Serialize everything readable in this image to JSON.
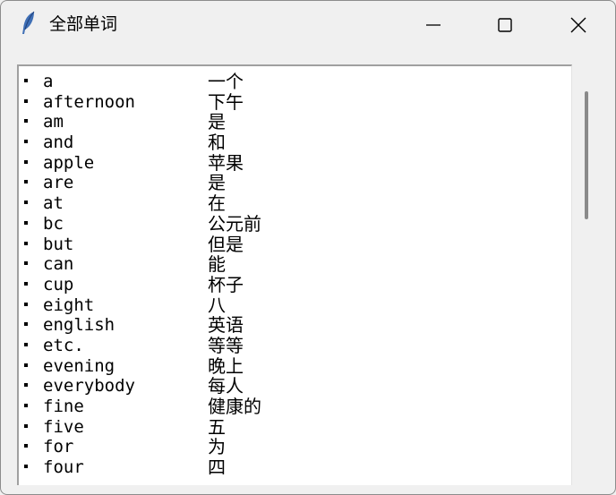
{
  "window": {
    "title": "全部单词",
    "icon": "feather-icon"
  },
  "controls": {
    "minimize_icon": "minimize-icon",
    "maximize_icon": "maximize-icon",
    "close_icon": "close-icon"
  },
  "list": {
    "items": [
      {
        "word": "a",
        "meaning": "一个"
      },
      {
        "word": "afternoon",
        "meaning": "下午"
      },
      {
        "word": "am",
        "meaning": "是"
      },
      {
        "word": "and",
        "meaning": "和"
      },
      {
        "word": "apple",
        "meaning": "苹果"
      },
      {
        "word": "are",
        "meaning": "是"
      },
      {
        "word": "at",
        "meaning": "在"
      },
      {
        "word": "bc",
        "meaning": "公元前"
      },
      {
        "word": "but",
        "meaning": "但是"
      },
      {
        "word": "can",
        "meaning": "能"
      },
      {
        "word": "cup",
        "meaning": "杯子"
      },
      {
        "word": "eight",
        "meaning": "八"
      },
      {
        "word": "english",
        "meaning": "英语"
      },
      {
        "word": "etc.",
        "meaning": "等等"
      },
      {
        "word": "evening",
        "meaning": "晚上"
      },
      {
        "word": "everybody",
        "meaning": "每人"
      },
      {
        "word": "fine",
        "meaning": "健康的"
      },
      {
        "word": "five",
        "meaning": "五"
      },
      {
        "word": "for",
        "meaning": "为"
      },
      {
        "word": "four",
        "meaning": "四"
      }
    ]
  },
  "scrollbar": {
    "position": 0.0,
    "visible_fraction": 0.33
  }
}
